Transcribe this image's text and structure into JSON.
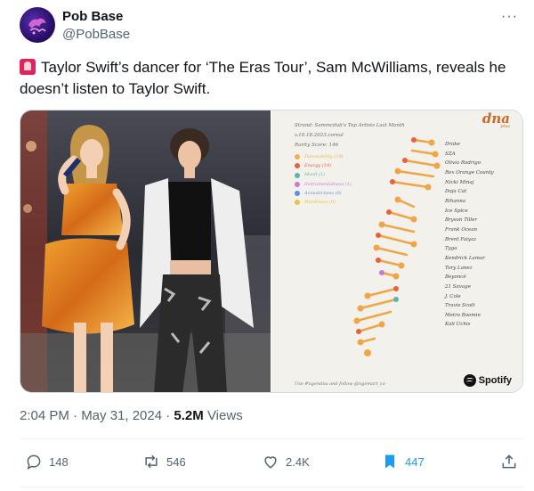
{
  "account": {
    "name": "Pob Base",
    "handle": "@PobBase"
  },
  "tweet": {
    "text": "Taylor Swift’s dancer for ‘The Eras Tour’, Sam McWilliams, reveals he doesn’t listen to Taylor Swift.",
    "time": "2:04 PM · May 31, 2024 · ",
    "views_count": "5.2M",
    "views_label": " Views"
  },
  "stats_card": {
    "header_lines": [
      "Strand: Sammcdub's Top Artists Last Month",
      "v.10.18.2023.coreal",
      "Rarity Score: 146"
    ],
    "logo": "dna",
    "logo_sub": "plus",
    "legend": [
      {
        "label": "Danceability (19)",
        "color": "#f0b14a"
      },
      {
        "label": "Energy (19)",
        "color": "#e8603c"
      },
      {
        "label": "Mood (1)",
        "color": "#59b7a6"
      },
      {
        "label": "Instrumentalness (1)",
        "color": "#c57ad8"
      },
      {
        "label": "Acousticness (0)",
        "color": "#5f8fe0"
      },
      {
        "label": "Wordiness (0)",
        "color": "#e8c33e"
      }
    ],
    "artists": [
      "Drake",
      "SZA",
      "Olivia Rodrigo",
      "Rex Orange County",
      "Nicki Minaj",
      "Doja Cat",
      "Rihanna",
      "Ice Spice",
      "Bryson Tiller",
      "Frank Ocean",
      "Brent Faiyaz",
      "Tyga",
      "Kendrick Lamar",
      "Tory Lanez",
      "Beyoncé",
      "21 Savage",
      "J. Cole",
      "Travis Scott",
      "Metro Boomin",
      "Kali Uchis"
    ],
    "footer": "Use #ngendna and follow @ngemart_co",
    "brand": "Spotify"
  },
  "actions": {
    "replies": "148",
    "reposts": "546",
    "likes": "2.4K",
    "bookmarks": "447"
  },
  "colors": {
    "accent": "#1d9bf0",
    "secondary_text": "#536471"
  }
}
